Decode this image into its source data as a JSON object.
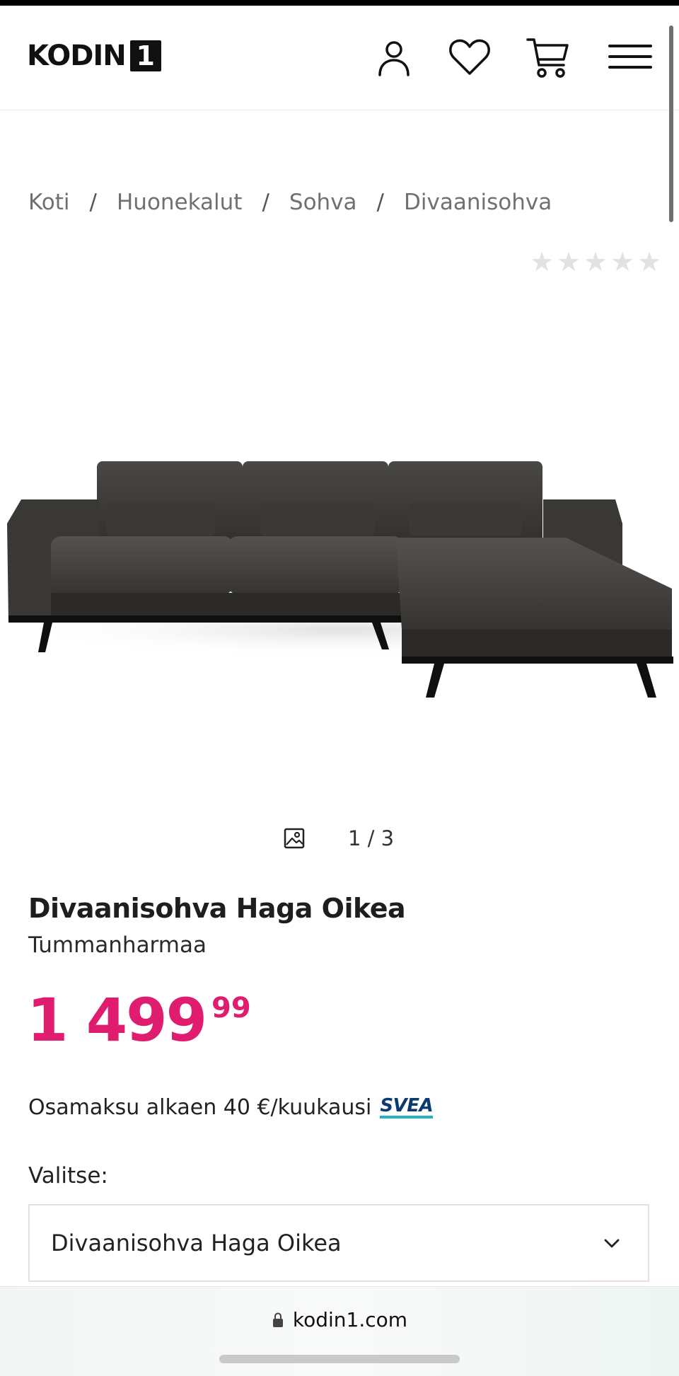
{
  "header": {
    "logo_text": "KODIN",
    "logo_number": "1",
    "icons": [
      "account-icon",
      "wishlist-heart-icon",
      "cart-icon",
      "menu-icon"
    ]
  },
  "breadcrumb": {
    "items": [
      "Koti",
      "Huonekalut",
      "Sohva",
      "Divaanisohva"
    ],
    "separator": "/"
  },
  "rating": {
    "stars_filled": 0,
    "stars_total": 5
  },
  "gallery": {
    "counter": "1 / 3"
  },
  "product": {
    "title": "Divaanisohva Haga Oikea",
    "subtitle": "Tummanharmaa",
    "price_main": "1 499",
    "price_cents": "99",
    "price_color": "#e01c6e",
    "installment_text": "Osamaksu alkaen 40 €/kuukausi",
    "installment_provider": "SVEA"
  },
  "variant_select": {
    "label": "Valitse:",
    "value": "Divaanisohva Haga Oikea"
  },
  "browser": {
    "url": "kodin1.com"
  }
}
